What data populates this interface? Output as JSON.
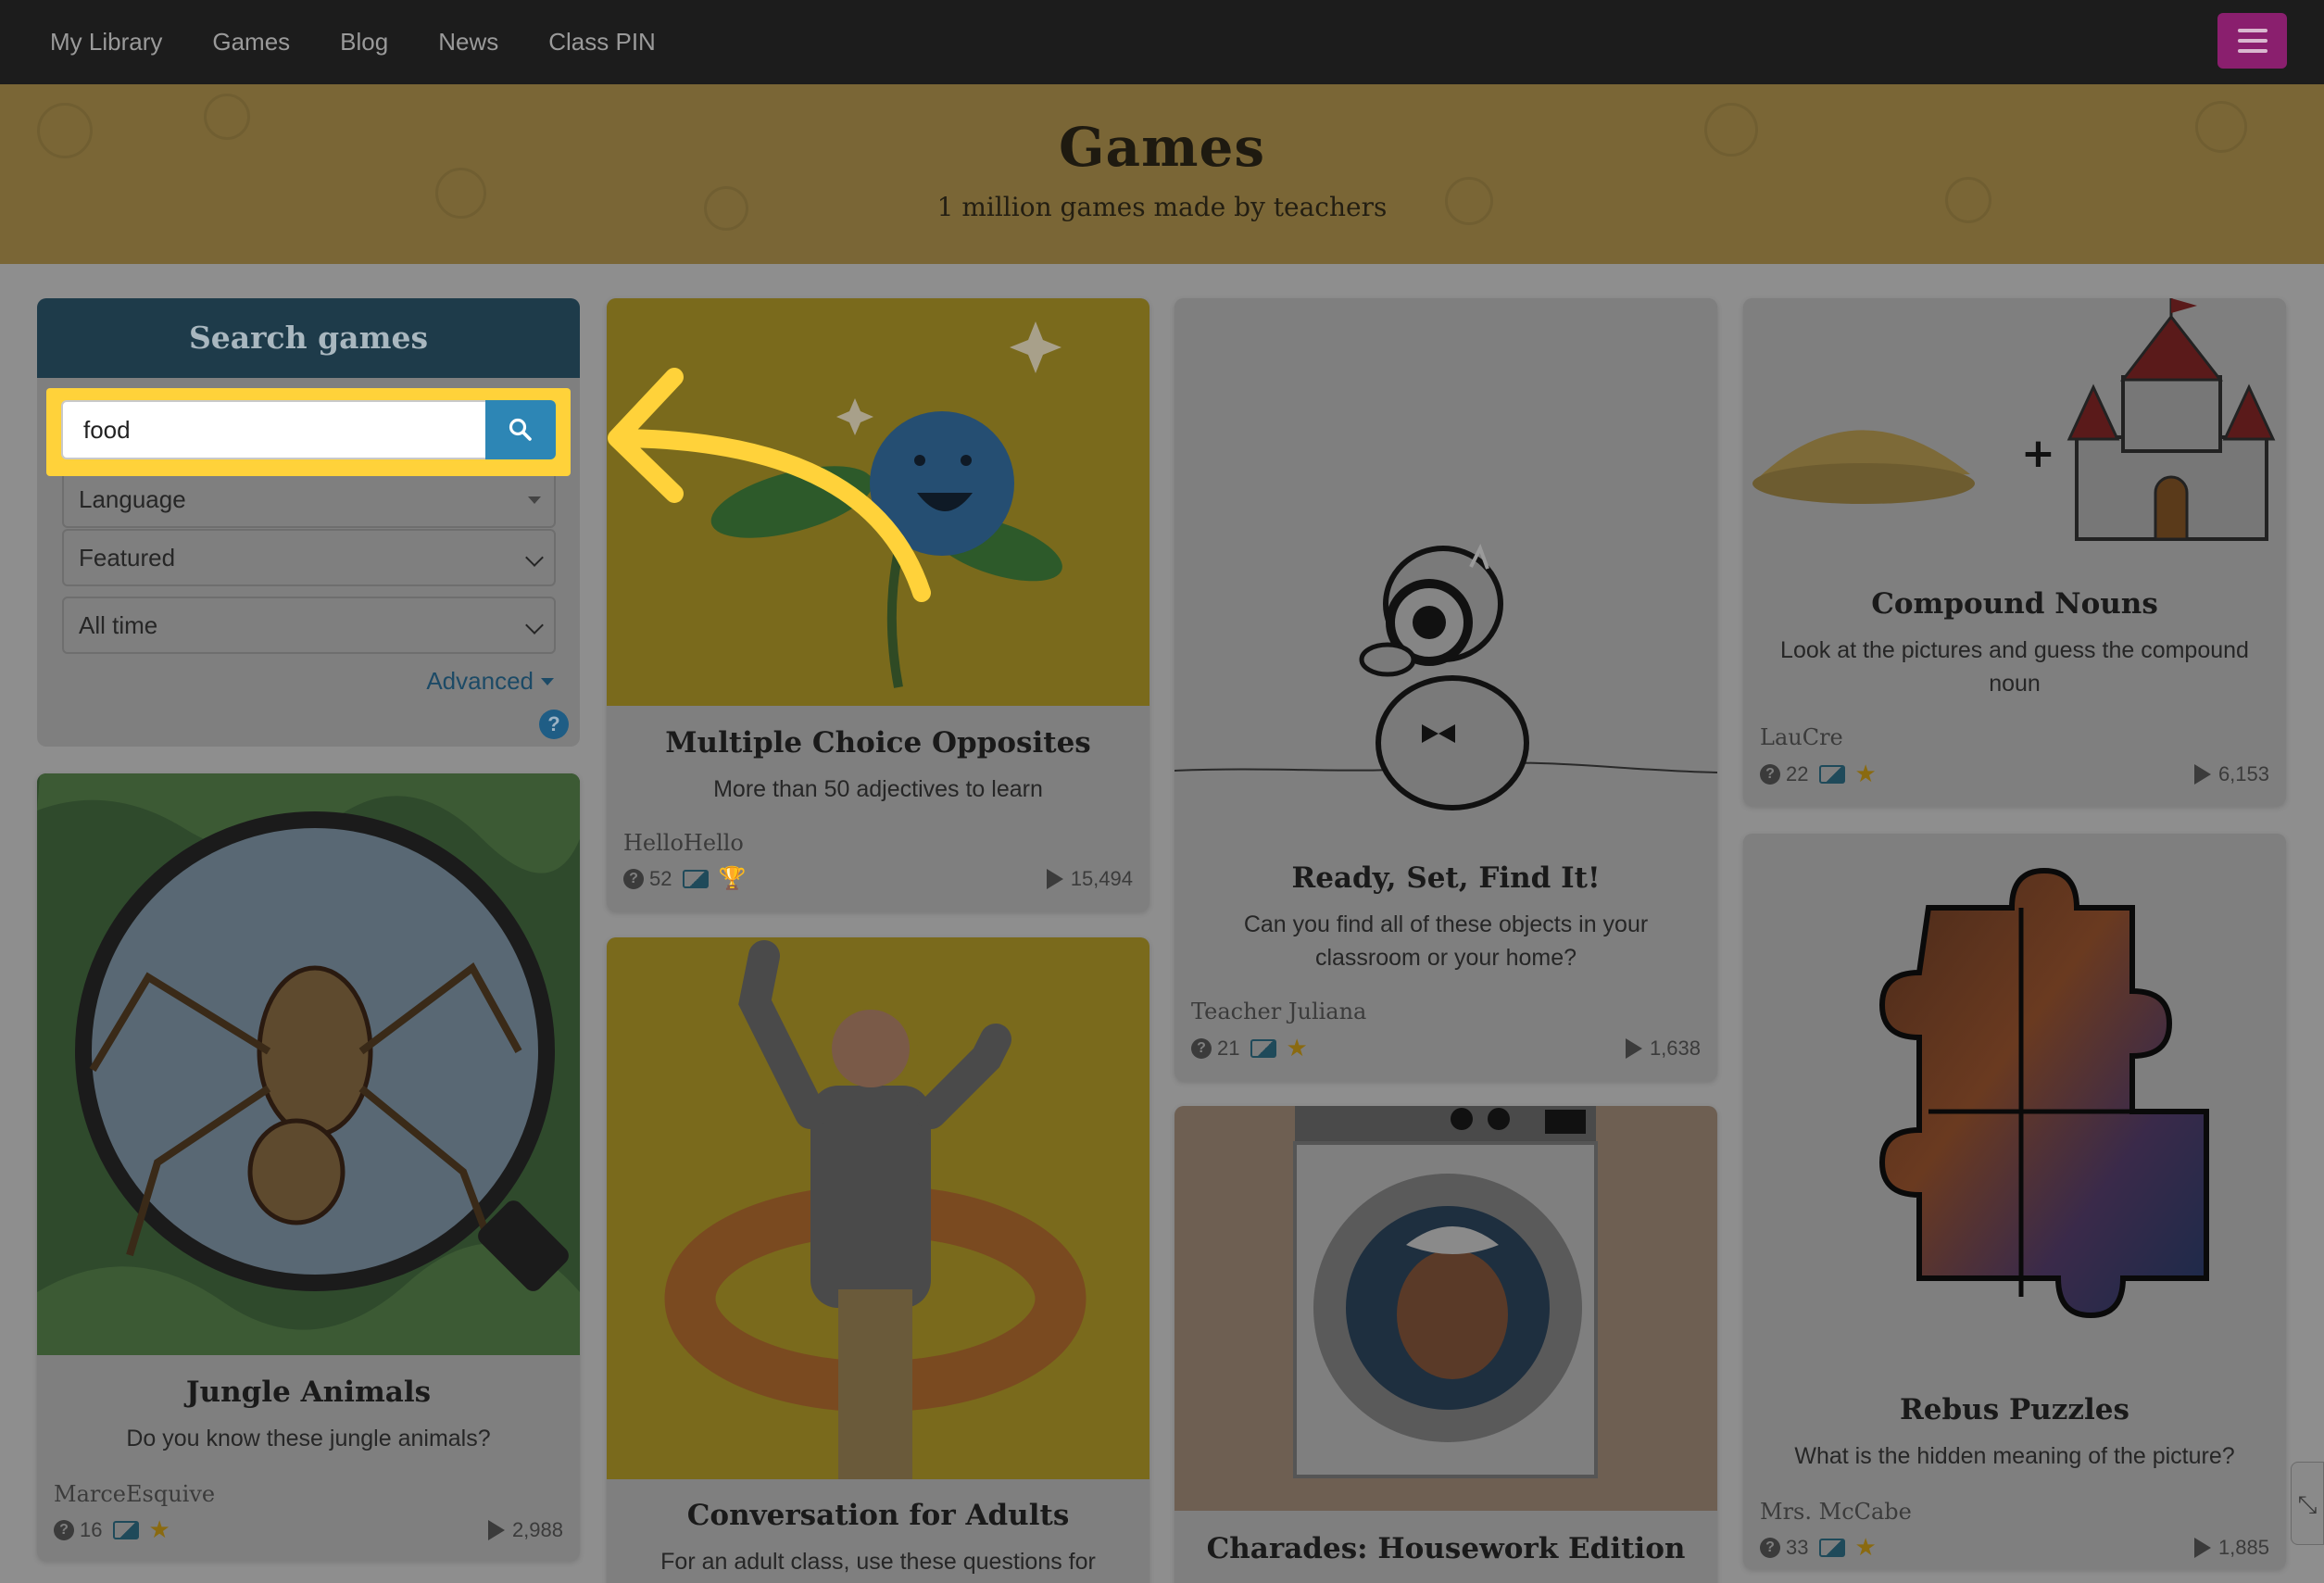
{
  "nav": {
    "links": [
      "My Library",
      "Games",
      "Blog",
      "News",
      "Class PIN"
    ],
    "menu_icon": "hamburger-menu-icon"
  },
  "hero": {
    "title": "Games",
    "subtitle": "1 million games made by teachers"
  },
  "search": {
    "heading": "Search games",
    "query": "food",
    "search_icon": "magnifier-icon",
    "language_label": "Language",
    "sort_label": "Featured",
    "time_label": "All time",
    "advanced_label": "Advanced",
    "help_icon": "question-circle-icon"
  },
  "cards": [
    {
      "title": "Multiple Choice Opposites",
      "description": "More than 50 adjectives to learn",
      "author": "HelloHello",
      "questions": "52",
      "plays": "15,494",
      "badge": "trophy",
      "image": "blue-flower-illustration"
    },
    {
      "title": "Ready, Set, Find It!",
      "description": "Can you find all of these objects in your classroom or your home?",
      "author": "Teacher Juliana",
      "questions": "21",
      "plays": "1,638",
      "badge": "star",
      "image": "detective-magnifier-cartoon"
    },
    {
      "title": "Compound Nouns",
      "description": "Look at the pictures and guess the compound noun",
      "author": "LauCre",
      "questions": "22",
      "plays": "6,153",
      "badge": "star",
      "image": "sand-plus-castle"
    },
    {
      "title": "Jungle Animals",
      "description": "Do you know these jungle animals?",
      "author": "MarceEsquive",
      "questions": "16",
      "plays": "2,988",
      "badge": "star",
      "image": "ant-under-magnifier"
    },
    {
      "title": "Conversation for Adults",
      "description": "For an adult class, use these questions for",
      "image": "dancing-man-photo"
    },
    {
      "title": "Charades: Housework Edition",
      "image": "washing-machine-cartoon"
    },
    {
      "title": "Rebus Puzzles",
      "description": "What is the hidden meaning of the picture?",
      "author": "Mrs. McCabe",
      "questions": "33",
      "plays": "1,885",
      "badge": "star",
      "image": "jigsaw-puzzle-pieces"
    }
  ],
  "colors": {
    "navbar": "#1c1c1c",
    "hero_dimmed": "#7a6636",
    "search_header": "#1e3b4a",
    "search_button": "#2d86b5",
    "highlight": "#ffd23a",
    "arrow": "#ffd23a",
    "menu_button": "#8a1f6e"
  }
}
